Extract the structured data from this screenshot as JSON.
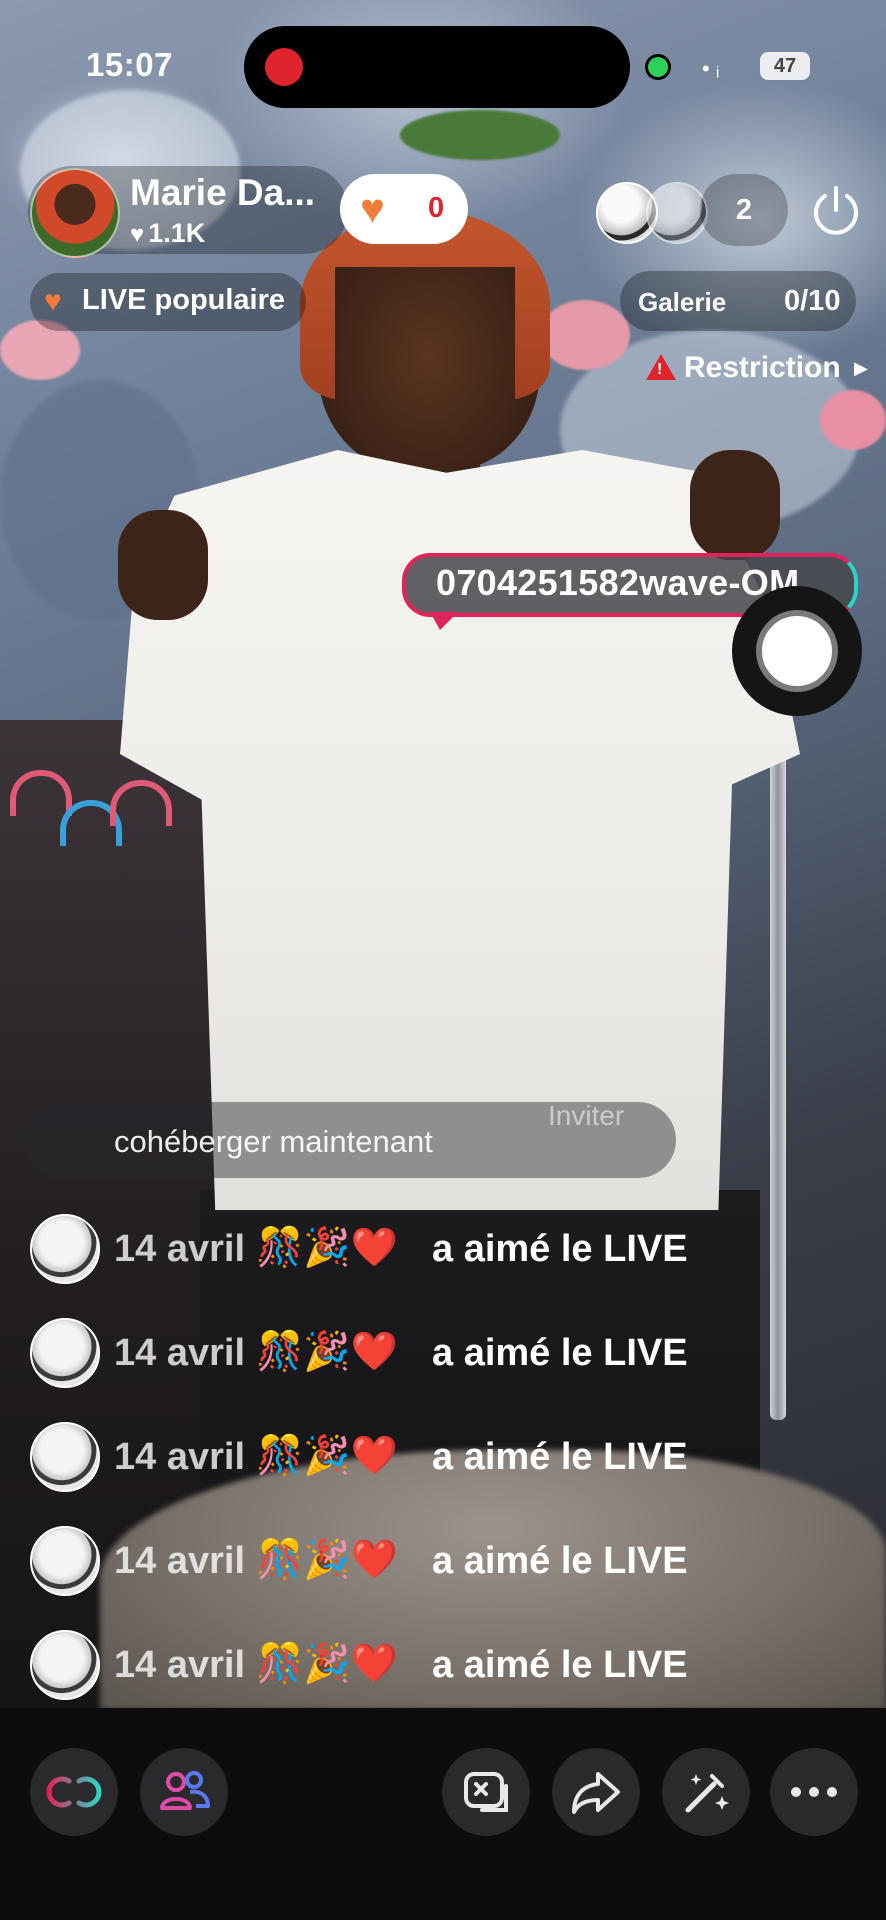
{
  "status_bar": {
    "time": "15:07",
    "battery": "47"
  },
  "host": {
    "name": "Marie Da...",
    "likes": "1.1K"
  },
  "like_counter": {
    "count": "0"
  },
  "viewers": {
    "count": "2"
  },
  "badges": {
    "popular_label": "LIVE populaire",
    "gallery_label": "Galerie",
    "gallery_count": "0/10",
    "restriction_label": "Restriction"
  },
  "pinned_comment": {
    "text": "0704251582wave-OM"
  },
  "cohost": {
    "label": "cohéberger maintenant",
    "invite_label": "Inviter"
  },
  "feed": [
    {
      "date": "14 avril",
      "emojis": "🎊🎉❤️",
      "message": "a aimé le LIVE"
    },
    {
      "date": "14 avril",
      "emojis": "🎊🎉❤️",
      "message": "a aimé le LIVE"
    },
    {
      "date": "14 avril",
      "emojis": "🎊🎉❤️",
      "message": "a aimé le LIVE"
    },
    {
      "date": "14 avril",
      "emojis": "🎊🎉❤️",
      "message": "a aimé le LIVE"
    },
    {
      "date": "14 avril",
      "emojis": "🎊🎉❤️",
      "message": "a aimé le LIVE"
    }
  ],
  "bottom_bar": {
    "icons": [
      "link-icon",
      "guests-icon",
      "comment-toggle-icon",
      "share-icon",
      "magic-wand-icon",
      "more-icon"
    ]
  },
  "colors": {
    "accent_pink": "#e0245a",
    "accent_cyan": "#2ad4c8",
    "heart_orange": "#f07d3a",
    "alert_red": "#e0242e"
  }
}
